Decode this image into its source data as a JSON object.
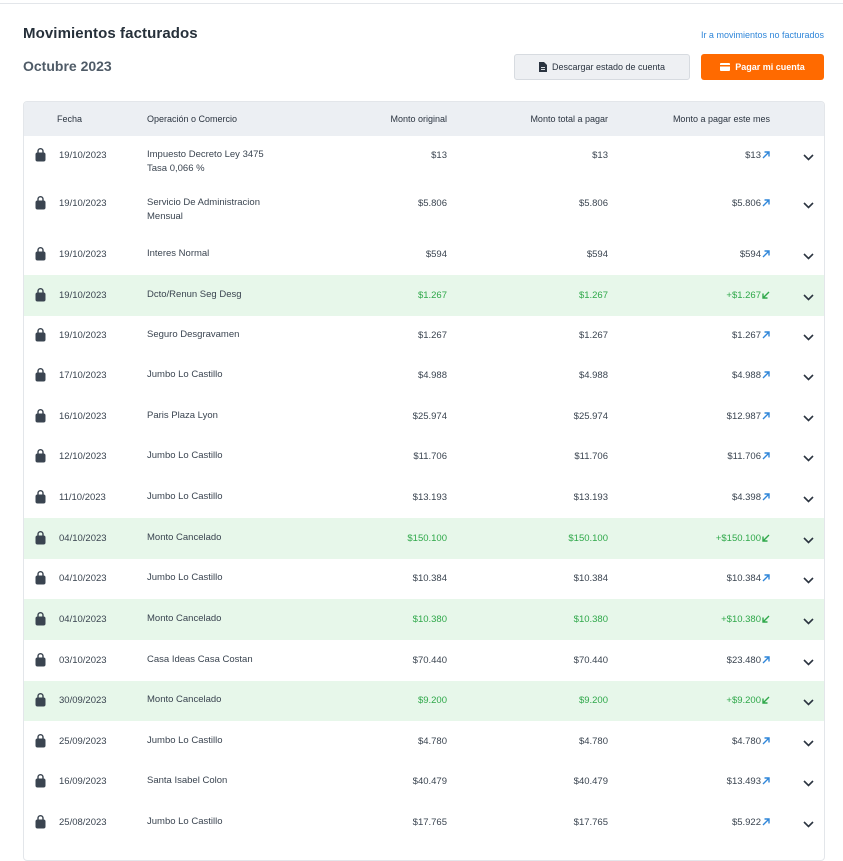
{
  "header": {
    "title": "Movimientos facturados",
    "period": "Octubre 2023",
    "link_label": "Ir a movimientos no facturados",
    "download_label": "Descargar estado de cuenta",
    "pay_label": "Pagar mi cuenta"
  },
  "colors": {
    "accent": "#ff6a00",
    "link": "#2f86d9",
    "credit": "#2fa84a",
    "credit_bg": "#e7f7ea"
  },
  "table": {
    "columns": [
      "Fecha",
      "Operación o Comercio",
      "Monto original",
      "Monto total a pagar",
      "Monto a pagar este mes"
    ],
    "rows": [
      {
        "date": "19/10/2023",
        "desc1": "Impuesto Decreto Ley 3475",
        "desc2": "Tasa 0,066 %",
        "original": "$13",
        "total": "$13",
        "month": "$13",
        "credit": false
      },
      {
        "date": "19/10/2023",
        "desc1": "Servicio De Administracion",
        "desc2": "Mensual",
        "original": "$5.806",
        "total": "$5.806",
        "month": "$5.806",
        "credit": false
      },
      {
        "date": "19/10/2023",
        "desc1": "Interes Normal",
        "desc2": "",
        "original": "$594",
        "total": "$594",
        "month": "$594",
        "credit": false
      },
      {
        "date": "19/10/2023",
        "desc1": "Dcto/Renun Seg Desg",
        "desc2": "",
        "original": "$1.267",
        "total": "$1.267",
        "month": "+$1.267",
        "credit": true
      },
      {
        "date": "19/10/2023",
        "desc1": "Seguro Desgravamen",
        "desc2": "",
        "original": "$1.267",
        "total": "$1.267",
        "month": "$1.267",
        "credit": false
      },
      {
        "date": "17/10/2023",
        "desc1": "Jumbo Lo Castillo",
        "desc2": "",
        "original": "$4.988",
        "total": "$4.988",
        "month": "$4.988",
        "credit": false
      },
      {
        "date": "16/10/2023",
        "desc1": "Paris Plaza Lyon",
        "desc2": "",
        "original": "$25.974",
        "total": "$25.974",
        "month": "$12.987",
        "credit": false
      },
      {
        "date": "12/10/2023",
        "desc1": "Jumbo Lo Castillo",
        "desc2": "",
        "original": "$11.706",
        "total": "$11.706",
        "month": "$11.706",
        "credit": false
      },
      {
        "date": "11/10/2023",
        "desc1": "Jumbo Lo Castillo",
        "desc2": "",
        "original": "$13.193",
        "total": "$13.193",
        "month": "$4.398",
        "credit": false
      },
      {
        "date": "04/10/2023",
        "desc1": "Monto Cancelado",
        "desc2": "",
        "original": "$150.100",
        "total": "$150.100",
        "month": "+$150.100",
        "credit": true
      },
      {
        "date": "04/10/2023",
        "desc1": "Jumbo Lo Castillo",
        "desc2": "",
        "original": "$10.384",
        "total": "$10.384",
        "month": "$10.384",
        "credit": false
      },
      {
        "date": "04/10/2023",
        "desc1": "Monto Cancelado",
        "desc2": "",
        "original": "$10.380",
        "total": "$10.380",
        "month": "+$10.380",
        "credit": true
      },
      {
        "date": "03/10/2023",
        "desc1": "Casa Ideas Casa Costan",
        "desc2": "",
        "original": "$70.440",
        "total": "$70.440",
        "month": "$23.480",
        "credit": false
      },
      {
        "date": "30/09/2023",
        "desc1": "Monto Cancelado",
        "desc2": "",
        "original": "$9.200",
        "total": "$9.200",
        "month": "+$9.200",
        "credit": true
      },
      {
        "date": "25/09/2023",
        "desc1": "Jumbo Lo Castillo",
        "desc2": "",
        "original": "$4.780",
        "total": "$4.780",
        "month": "$4.780",
        "credit": false
      },
      {
        "date": "16/09/2023",
        "desc1": "Santa Isabel Colon",
        "desc2": "",
        "original": "$40.479",
        "total": "$40.479",
        "month": "$13.493",
        "credit": false
      },
      {
        "date": "25/08/2023",
        "desc1": "Jumbo Lo Castillo",
        "desc2": "",
        "original": "$17.765",
        "total": "$17.765",
        "month": "$5.922",
        "credit": false
      }
    ]
  }
}
